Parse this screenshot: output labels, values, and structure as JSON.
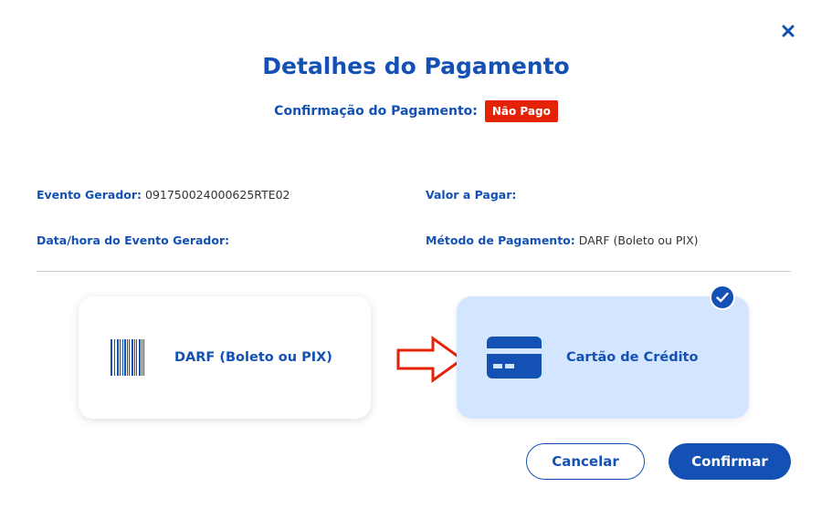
{
  "dialog": {
    "close_glyph": "✕",
    "title": "Detalhes do Pagamento",
    "confirmation_label": "Confirmação do Pagamento:",
    "status": "Não Pago",
    "status_color": "#e52207",
    "accent_color": "#1351b4"
  },
  "details": {
    "evento_gerador_label": "Evento Gerador:",
    "evento_gerador_value": "091750024000625RTE02",
    "valor_label": "Valor a Pagar:",
    "valor_value": "",
    "data_hora_label": "Data/hora do Evento Gerador:",
    "data_hora_value": "",
    "metodo_label": "Método de Pagamento:",
    "metodo_value": "DARF (Boleto ou PIX)"
  },
  "options": {
    "darf": {
      "label": "DARF (Boleto ou PIX)",
      "icon": "barcode-icon",
      "selected": false
    },
    "credit_card": {
      "label": "Cartão de Crédito",
      "icon": "credit-card-icon",
      "selected": true
    }
  },
  "actions": {
    "cancel_label": "Cancelar",
    "confirm_label": "Confirmar"
  }
}
